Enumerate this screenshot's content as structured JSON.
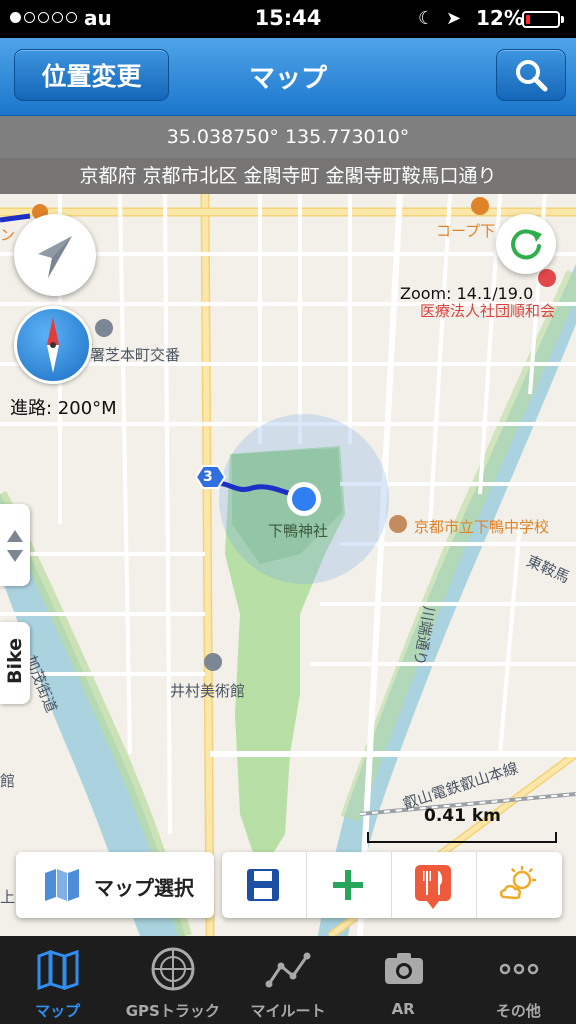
{
  "status_bar": {
    "carrier": "au",
    "time": "15:44",
    "battery": "12%",
    "battery_level": 0.12
  },
  "nav": {
    "left_button": "位置変更",
    "title": "マップ",
    "right_icon": "search-icon"
  },
  "info": {
    "coordinates": "35.038750° 135.773010°",
    "address": "京都府 京都市北区 金閣寺町 金閣寺町鞍馬口通り"
  },
  "map": {
    "heading": "進路: 200°M",
    "zoom": "Zoom: 14.1/19.0",
    "scale": "0.41 km",
    "bike_label": "Bike",
    "labels": {
      "shrine": "下鴨神社",
      "school": "京都市立下鴨中学校",
      "museum": "井村美術館",
      "koban": "署芝本町交番",
      "clinic": "医療法人社団順和会",
      "coop": "コープ下",
      "railway": "叡山電鉄叡山本線",
      "kamo_river_road": "加茂街道",
      "kawabata": "川端通り",
      "higashi": "東鞍馬",
      "route_badge": "3",
      "left_edge_1": "ン",
      "left_edge_2": "館",
      "left_edge_3": "上京"
    }
  },
  "toolbar": {
    "map_select": "マップ選択",
    "tools": [
      "save-icon",
      "add-icon",
      "restaurant-icon",
      "weather-icon"
    ]
  },
  "tabs": [
    {
      "label": "マップ",
      "icon": "map-icon",
      "active": true
    },
    {
      "label": "GPSトラック",
      "icon": "radar-icon",
      "active": false
    },
    {
      "label": "マイルート",
      "icon": "route-icon",
      "active": false
    },
    {
      "label": "AR",
      "icon": "camera-icon",
      "active": false
    },
    {
      "label": "その他",
      "icon": "more-icon",
      "active": false
    }
  ]
}
